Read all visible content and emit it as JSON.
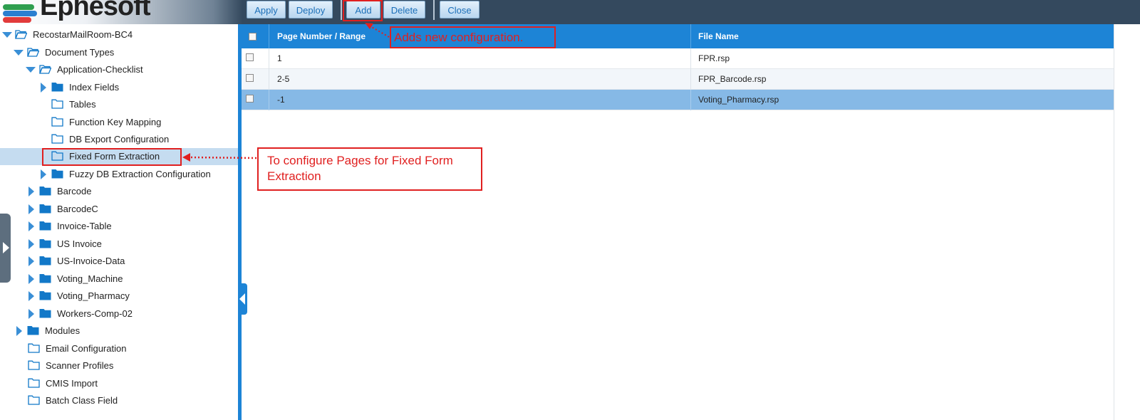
{
  "app": {
    "logo_text": "Ephesoft"
  },
  "toolbar": {
    "apply_label": "Apply",
    "deploy_label": "Deploy",
    "add_label": "Add",
    "delete_label": "Delete",
    "close_label": "Close"
  },
  "tree": {
    "root": "RecostarMailRoom-BC4",
    "document_types": "Document Types",
    "application_checklist": "Application-Checklist",
    "index_fields": "Index Fields",
    "tables": "Tables",
    "function_key_mapping": "Function Key Mapping",
    "db_export_configuration": "DB Export Configuration",
    "fixed_form_extraction": "Fixed Form Extraction",
    "fuzzy_db_extraction": "Fuzzy DB Extraction Configuration",
    "doc_types": [
      "Barcode",
      "BarcodeC",
      "Invoice-Table",
      "US Invoice",
      "US-Invoice-Data",
      "Voting_Machine",
      "Voting_Pharmacy",
      "Workers-Comp-02"
    ],
    "modules": "Modules",
    "email_configuration": "Email Configuration",
    "scanner_profiles": "Scanner Profiles",
    "cmis_import": "CMIS Import",
    "batch_class_field": "Batch Class Field"
  },
  "grid": {
    "columns": [
      "Page Number / Range",
      "File Name"
    ],
    "rows": [
      {
        "page": "1",
        "file": "FPR.rsp",
        "selected": false
      },
      {
        "page": "2-5",
        "file": "FPR_Barcode.rsp",
        "selected": false
      },
      {
        "page": "-1",
        "file": "Voting_Pharmacy.rsp",
        "selected": true
      }
    ]
  },
  "annotations": {
    "add_note": "Adds new configuration.",
    "fixed_form_note_line1": "To configure Pages for Fixed Form",
    "fixed_form_note_line2": "Extraction"
  },
  "colors": {
    "accent": "#1d84d6",
    "header_dark": "#34495e",
    "annotation": "#e02020",
    "selected_row": "#86b9e6",
    "selected_tree": "#c5dcf0",
    "folder": "#1278c8"
  },
  "logo_colors": [
    "#2e9e4f",
    "#2b7fd0",
    "#e23b3b"
  ]
}
